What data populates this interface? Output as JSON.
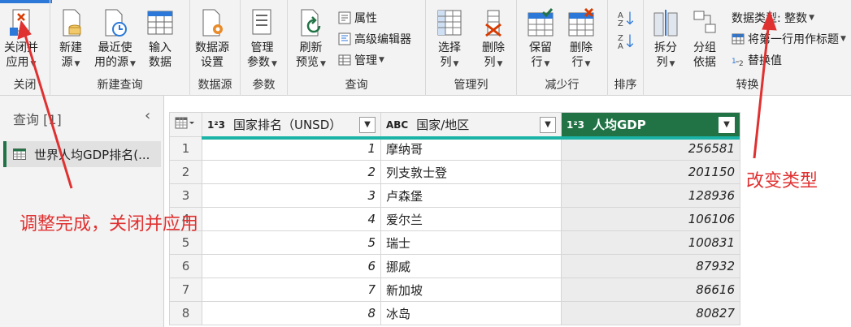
{
  "ribbon": {
    "close": {
      "btn_l1": "关闭并",
      "btn_l2": "应用",
      "label": "关闭"
    },
    "newquery": {
      "new_l1": "新建",
      "new_l2": "源",
      "recent_l1": "最近使",
      "recent_l2": "用的源",
      "enter_l1": "输入",
      "enter_l2": "数据",
      "label": "新建查询"
    },
    "datasource": {
      "l1": "数据源",
      "l2": "设置",
      "label": "数据源"
    },
    "params": {
      "l1": "管理",
      "l2": "参数",
      "label": "参数"
    },
    "query": {
      "refresh_l1": "刷新",
      "refresh_l2": "预览",
      "properties": "属性",
      "advanced": "高级编辑器",
      "manage": "管理",
      "label": "查询"
    },
    "columns": {
      "choose_l1": "选择",
      "choose_l2": "列",
      "remove_l1": "删除",
      "remove_l2": "列",
      "label": "管理列"
    },
    "rows": {
      "keep_l1": "保留",
      "keep_l2": "行",
      "remove_l1": "删除",
      "remove_l2": "行",
      "label": "减少行"
    },
    "sort": {
      "label": "排序"
    },
    "transform": {
      "split_l1": "拆分",
      "split_l2": "列",
      "group_l1": "分组",
      "group_l2": "依据",
      "datatype": "数据类型: 整数",
      "firstrow": "将第一行用作标题",
      "replace": "替换值",
      "label": "转换"
    }
  },
  "queries": {
    "title": "查询 [1]",
    "item": "世界人均GDP排名(..."
  },
  "table": {
    "columns": [
      {
        "type": "1²3",
        "name": "国家排名（UNSD）"
      },
      {
        "type": "ABC",
        "name": "国家/地区"
      },
      {
        "type": "1²3",
        "name": "人均GDP"
      }
    ],
    "rows": [
      {
        "n": "1",
        "rank": "1",
        "country": "摩纳哥",
        "gdp": "256581"
      },
      {
        "n": "2",
        "rank": "2",
        "country": "列支敦士登",
        "gdp": "201150"
      },
      {
        "n": "3",
        "rank": "3",
        "country": "卢森堡",
        "gdp": "128936"
      },
      {
        "n": "4",
        "rank": "4",
        "country": "爱尔兰",
        "gdp": "106106"
      },
      {
        "n": "5",
        "rank": "5",
        "country": "瑞士",
        "gdp": "100831"
      },
      {
        "n": "6",
        "rank": "6",
        "country": "挪威",
        "gdp": "87932"
      },
      {
        "n": "7",
        "rank": "7",
        "country": "新加坡",
        "gdp": "86616"
      },
      {
        "n": "8",
        "rank": "8",
        "country": "冰岛",
        "gdp": "80827"
      }
    ]
  },
  "annotations": {
    "close_note": "调整完成，关闭并应用",
    "type_note": "改变类型"
  },
  "colors": {
    "accent": "#217346",
    "annotation": "#e03131",
    "quality_bar": "#1ab3a6"
  }
}
